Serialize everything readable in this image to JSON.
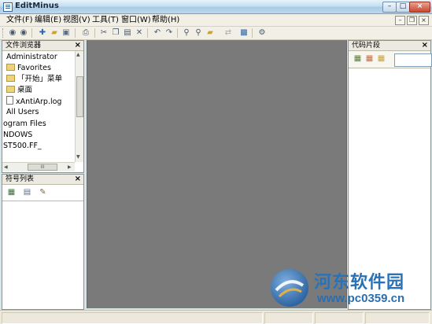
{
  "window": {
    "title": "EditMinus"
  },
  "menu": {
    "file": "文件(F)",
    "edit": "编辑(E)",
    "view": "视图(V)",
    "tools": "工具(T)",
    "window": "窗口(W)",
    "help": "帮助(H)"
  },
  "file_browser": {
    "title": "文件浏览器",
    "items": [
      {
        "label": "Administrator",
        "icon": "none"
      },
      {
        "label": "Favorites",
        "icon": "folder-icon"
      },
      {
        "label": "「开始」菜单",
        "icon": "folder-icon"
      },
      {
        "label": "桌面",
        "icon": "folder-icon"
      },
      {
        "label": "xAntiArp.log",
        "icon": "file-icon"
      },
      {
        "label": "All Users",
        "icon": "none"
      },
      {
        "label": "ogram Files",
        "icon": "none"
      },
      {
        "label": "NDOWS",
        "icon": "none"
      },
      {
        "label": "ST500.FF_",
        "icon": "none"
      }
    ],
    "hscroll_grip": "III"
  },
  "symbol_list": {
    "title": "符号列表"
  },
  "code_snippets": {
    "title": "代码片段",
    "search_value": ""
  },
  "watermark": {
    "line1": "河东软件园",
    "line2": "www.pc0359.cn"
  },
  "colors": {
    "editor_bg": "#7a7a7a",
    "watermark_blue": "#2a72b8"
  }
}
